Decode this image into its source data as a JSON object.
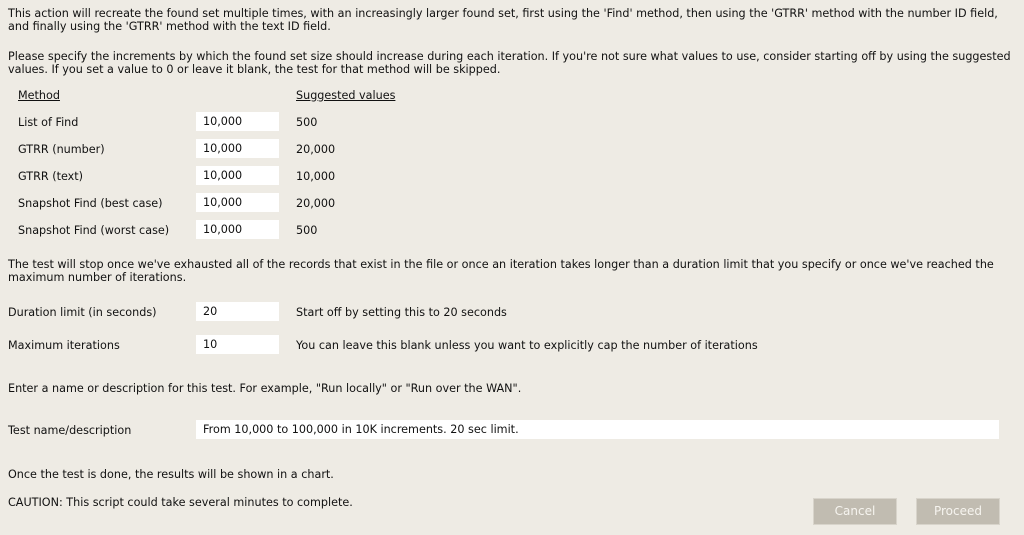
{
  "intro": {
    "line1": "This action will recreate the found set multiple times, with an increasingly larger found set, first using the 'Find' method, then using the 'GTRR' method with the number ID field, and finally using the 'GTRR' method with the text ID field.",
    "line2": "Please specify the increments by which the found set size should increase during each iteration. If you're not sure what values to use, consider starting off by using the suggested values. If you set a value to 0 or leave it blank, the test for that method will be skipped."
  },
  "methods_table": {
    "header_method": "Method",
    "header_suggested": "Suggested values",
    "rows": [
      {
        "label": "List of Find",
        "value": "10,000",
        "suggested": "500"
      },
      {
        "label": "GTRR (number)",
        "value": "10,000",
        "suggested": "20,000"
      },
      {
        "label": "GTRR (text)",
        "value": "10,000",
        "suggested": "10,000"
      },
      {
        "label": "Snapshot Find (best case)",
        "value": "10,000",
        "suggested": "20,000"
      },
      {
        "label": "Snapshot Find (worst case)",
        "value": "10,000",
        "suggested": "500"
      }
    ]
  },
  "stop_info": "The test will stop once we've exhausted all of the records that exist in the file or once an iteration takes longer than a duration limit that you specify or once we've reached the maximum number of iterations.",
  "limits": {
    "duration": {
      "label": "Duration limit (in seconds)",
      "value": "20",
      "hint": "Start off by setting this to 20 seconds"
    },
    "max_iterations": {
      "label": "Maximum iterations",
      "value": "10",
      "hint": "You can leave this blank unless you want to explicitly cap the number of iterations"
    }
  },
  "name_prompt": "Enter a name or description for this test. For example, \"Run locally\" or \"Run over the WAN\".",
  "test_name": {
    "label": "Test name/description",
    "value": "From 10,000 to 100,000 in 10K increments. 20 sec limit."
  },
  "result_note": "Once the test is done, the results will be shown in a chart.",
  "caution": "CAUTION: This script could take several minutes to complete.",
  "buttons": {
    "cancel": "Cancel",
    "proceed": "Proceed"
  }
}
